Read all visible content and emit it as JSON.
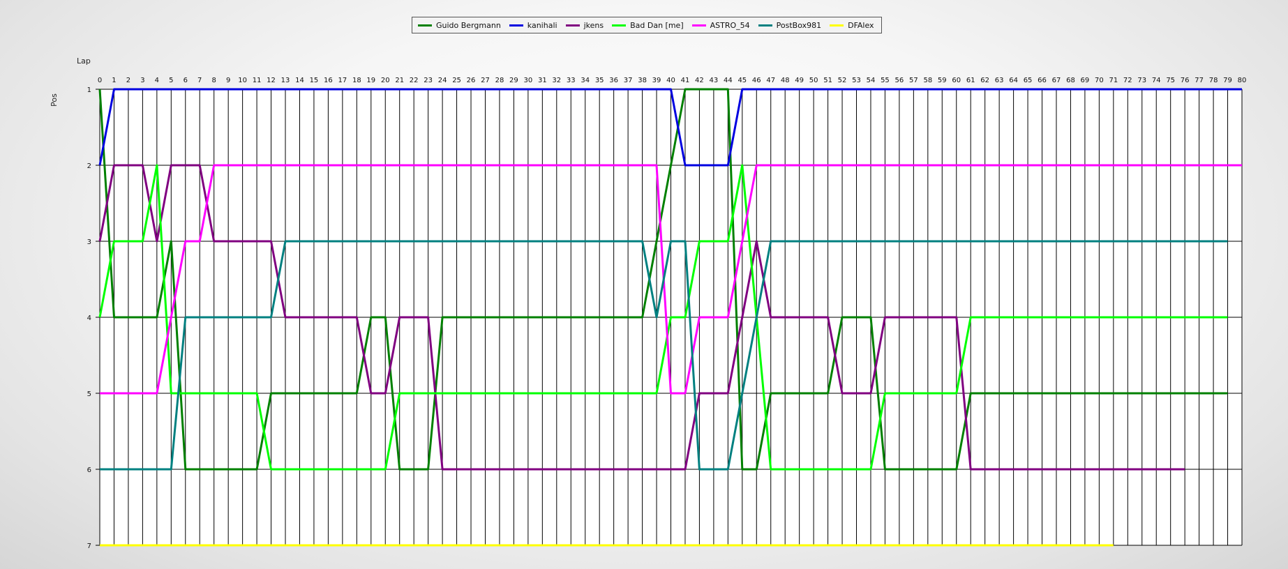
{
  "chart_data": {
    "type": "line",
    "xlabel": "Lap",
    "ylabel": "Pos",
    "xlim": [
      0,
      80
    ],
    "ylim": [
      1,
      7
    ],
    "y_reversed": true,
    "y_ticks": [
      1,
      2,
      3,
      4,
      5,
      6,
      7
    ],
    "grid": true,
    "legend_position": "top-center",
    "series": [
      {
        "name": "Guido Bergmann",
        "color": "#008000",
        "points": [
          [
            0,
            1
          ],
          [
            1,
            4
          ],
          [
            4,
            4
          ],
          [
            5,
            3
          ],
          [
            6,
            6
          ],
          [
            11,
            6
          ],
          [
            12,
            5
          ],
          [
            18,
            5
          ],
          [
            19,
            4
          ],
          [
            20,
            4
          ],
          [
            21,
            6
          ],
          [
            23,
            6
          ],
          [
            24,
            4
          ],
          [
            38,
            4
          ],
          [
            39,
            3
          ],
          [
            40,
            2
          ],
          [
            41,
            1
          ],
          [
            44,
            1
          ],
          [
            45,
            6
          ],
          [
            46,
            6
          ],
          [
            47,
            5
          ],
          [
            51,
            5
          ],
          [
            52,
            4
          ],
          [
            54,
            4
          ],
          [
            55,
            6
          ],
          [
            60,
            6
          ],
          [
            61,
            5
          ],
          [
            79,
            5
          ]
        ]
      },
      {
        "name": "kanihali",
        "color": "#0000e0",
        "points": [
          [
            0,
            2
          ],
          [
            1,
            1
          ],
          [
            40,
            1
          ],
          [
            41,
            2
          ],
          [
            44,
            2
          ],
          [
            45,
            1
          ],
          [
            80,
            1
          ]
        ]
      },
      {
        "name": "jkens",
        "color": "#800080",
        "points": [
          [
            0,
            3
          ],
          [
            1,
            2
          ],
          [
            3,
            2
          ],
          [
            4,
            3
          ],
          [
            5,
            2
          ],
          [
            7,
            2
          ],
          [
            8,
            3
          ],
          [
            12,
            3
          ],
          [
            13,
            4
          ],
          [
            18,
            4
          ],
          [
            19,
            5
          ],
          [
            20,
            5
          ],
          [
            21,
            4
          ],
          [
            23,
            4
          ],
          [
            24,
            6
          ],
          [
            41,
            6
          ],
          [
            42,
            5
          ],
          [
            44,
            5
          ],
          [
            45,
            4
          ],
          [
            46,
            3
          ],
          [
            47,
            4
          ],
          [
            51,
            4
          ],
          [
            52,
            5
          ],
          [
            54,
            5
          ],
          [
            55,
            4
          ],
          [
            60,
            4
          ],
          [
            61,
            6
          ],
          [
            76,
            6
          ]
        ]
      },
      {
        "name": "Bad Dan [me]",
        "color": "#00ff00",
        "points": [
          [
            0,
            4
          ],
          [
            1,
            3
          ],
          [
            3,
            3
          ],
          [
            4,
            2
          ],
          [
            5,
            5
          ],
          [
            11,
            5
          ],
          [
            12,
            6
          ],
          [
            20,
            6
          ],
          [
            21,
            5
          ],
          [
            39,
            5
          ],
          [
            40,
            4
          ],
          [
            41,
            4
          ],
          [
            42,
            3
          ],
          [
            44,
            3
          ],
          [
            45,
            2
          ],
          [
            46,
            4
          ],
          [
            47,
            6
          ],
          [
            54,
            6
          ],
          [
            55,
            5
          ],
          [
            60,
            5
          ],
          [
            61,
            4
          ],
          [
            79,
            4
          ]
        ]
      },
      {
        "name": "ASTRO_54",
        "color": "#ff00ff",
        "points": [
          [
            0,
            5
          ],
          [
            4,
            5
          ],
          [
            5,
            4
          ],
          [
            6,
            3
          ],
          [
            7,
            3
          ],
          [
            8,
            2
          ],
          [
            39,
            2
          ],
          [
            40,
            5
          ],
          [
            41,
            5
          ],
          [
            42,
            4
          ],
          [
            44,
            4
          ],
          [
            45,
            3
          ],
          [
            46,
            2
          ],
          [
            80,
            2
          ]
        ]
      },
      {
        "name": "PostBox981",
        "color": "#008080",
        "points": [
          [
            0,
            6
          ],
          [
            5,
            6
          ],
          [
            6,
            4
          ],
          [
            12,
            4
          ],
          [
            13,
            3
          ],
          [
            38,
            3
          ],
          [
            39,
            4
          ],
          [
            40,
            3
          ],
          [
            41,
            3
          ],
          [
            42,
            6
          ],
          [
            44,
            6
          ],
          [
            45,
            5
          ],
          [
            46,
            4
          ],
          [
            47,
            3
          ],
          [
            79,
            3
          ]
        ]
      },
      {
        "name": "DFAlex",
        "color": "#ffff00",
        "points": [
          [
            0,
            7
          ],
          [
            71,
            7
          ]
        ]
      }
    ]
  }
}
